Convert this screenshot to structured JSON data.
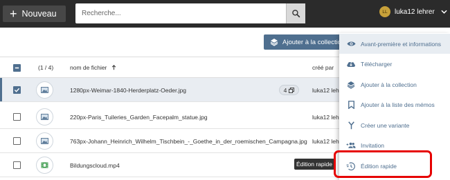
{
  "topbar": {
    "new_button_label": "Nouveau",
    "search_placeholder": "Recherche...",
    "user_initials": "LL",
    "user_name": "luka12 lehrer"
  },
  "toolbar": {
    "add_to_collection_label": "Ajouter à la collection"
  },
  "table": {
    "count": "(1 / 4)",
    "columns": {
      "name": "nom de fichier",
      "created_by": "créé par"
    },
    "rows": [
      {
        "name": "1280px-Weimar-1840-Herderplatz-Oeder.jpg",
        "created_by": "luka12 lehr",
        "selected": true,
        "badge": "4",
        "thumb_icon": "image-icon"
      },
      {
        "name": "220px-Paris_Tuileries_Garden_Facepalm_statue.jpg",
        "created_by": "luka12 lehr",
        "selected": false,
        "thumb_icon": "image-icon"
      },
      {
        "name": "763px-Johann_Heinrich_Wilhelm_Tischbein_-_Goethe_in_der_roemischen_Campagna.jpg",
        "created_by": "luka12 lehr",
        "selected": false,
        "thumb_icon": "image-icon"
      },
      {
        "name": "Bildungscloud.mp4",
        "created_by": "",
        "selected": false,
        "thumb_icon": "video-icon"
      }
    ]
  },
  "tooltip": "Édition rapide",
  "context_menu": {
    "items": [
      {
        "label": "Avant-première et informations",
        "icon": "eye-icon"
      },
      {
        "label": "Télécharger",
        "icon": "cloud-download-icon"
      },
      {
        "label": "Ajouter à la collection",
        "icon": "layers-icon"
      },
      {
        "label": "Ajouter à la liste des mémos",
        "icon": "bookmark-icon"
      },
      {
        "label": "Créer une variante",
        "icon": "fork-icon"
      },
      {
        "label": "Invitation",
        "icon": "people-add-icon"
      },
      {
        "label": "Édition rapide",
        "icon": "quick-edit-icon"
      }
    ]
  },
  "colors": {
    "topbar": "#2b2b2b",
    "accent": "#4f6f8f",
    "highlight": "#e60000"
  }
}
